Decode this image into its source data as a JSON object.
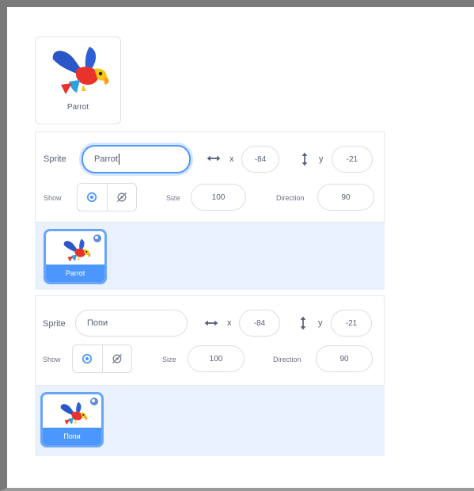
{
  "thumbnail": {
    "name": "Parrot"
  },
  "panels": [
    {
      "sprite_label": "Sprite",
      "sprite_name": "Parrot",
      "x_label": "x",
      "x_value": "-84",
      "y_label": "y",
      "y_value": "-21",
      "show_label": "Show",
      "size_label": "Size",
      "size_value": "100",
      "direction_label": "Direction",
      "direction_value": "90",
      "tile_name": "Parrot"
    },
    {
      "sprite_label": "Sprite",
      "sprite_name": "Попи",
      "x_label": "x",
      "x_value": "-84",
      "y_label": "y",
      "y_value": "-21",
      "show_label": "Show",
      "size_label": "Size",
      "size_value": "100",
      "direction_label": "Direction",
      "direction_value": "90",
      "tile_name": "Попи"
    }
  ],
  "colors": {
    "accent": "#4c97ff",
    "list_bg": "#e9f1fc",
    "frame": "#7a7a7a"
  },
  "icons": [
    "x-position-arrows-icon",
    "y-position-arrows-icon",
    "show-eye-icon",
    "hide-eye-icon",
    "delete-sprite-icon",
    "parrot-sprite-image"
  ]
}
